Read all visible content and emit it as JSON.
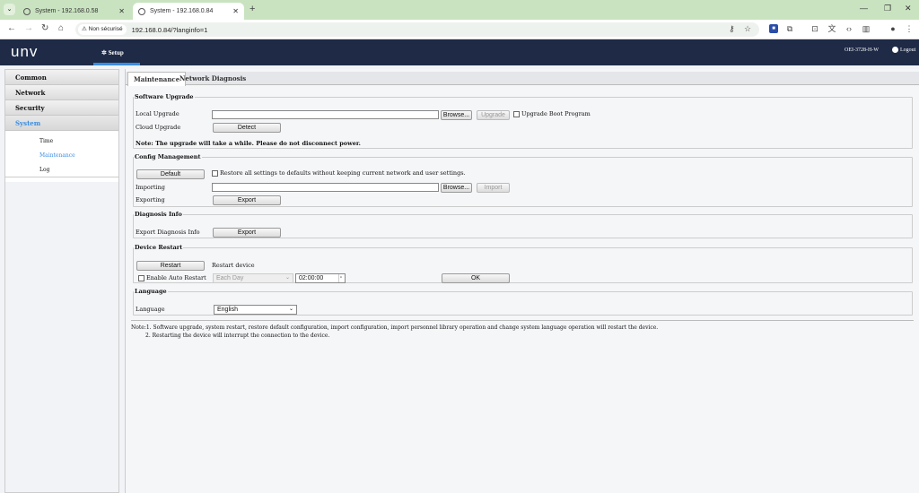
{
  "browser": {
    "tabs": [
      {
        "title": "System - 192.168.0.58"
      },
      {
        "title": "System - 192.168.0.84"
      }
    ],
    "security_label": "Non sécurisé",
    "url": "192.168.0.84/?langinfo=1"
  },
  "header": {
    "logo": "unv",
    "setup_label": "Setup",
    "device_model": "OEI-3728-H-W",
    "logout_label": "Logout"
  },
  "sidebar": {
    "groups": [
      {
        "label": "Common"
      },
      {
        "label": "Network"
      },
      {
        "label": "Security"
      },
      {
        "label": "System"
      }
    ],
    "system_items": [
      {
        "label": "Time"
      },
      {
        "label": "Maintenance"
      },
      {
        "label": "Log"
      }
    ]
  },
  "tabs": [
    {
      "label": "Maintenance"
    },
    {
      "label": "Network Diagnosis"
    }
  ],
  "software_upgrade": {
    "legend": "Software Upgrade",
    "local_upgrade_label": "Local Upgrade",
    "browse_label": "Browse...",
    "upgrade_label": "Upgrade",
    "boot_program_label": "Upgrade Boot Program",
    "cloud_upgrade_label": "Cloud Upgrade",
    "detect_label": "Detect",
    "note": "Note: The upgrade will take a while. Please do not disconnect power."
  },
  "config_management": {
    "legend": "Config Management",
    "default_label": "Default",
    "restore_label": "Restore all settings to defaults without keeping current network and user settings.",
    "importing_label": "Importing",
    "browse_label": "Browse...",
    "import_label": "Import",
    "exporting_label": "Exporting",
    "export_label": "Export"
  },
  "diagnosis_info": {
    "legend": "Diagnosis Info",
    "export_info_label": "Export Diagnosis Info",
    "export_label": "Export"
  },
  "device_restart": {
    "legend": "Device Restart",
    "restart_label": "Restart",
    "restart_device_label": "Restart device",
    "auto_restart_label": "Enable Auto Restart",
    "frequency_value": "Each Day",
    "time_value": "02:00:00",
    "ok_label": "OK"
  },
  "language": {
    "legend": "Language",
    "label": "Language",
    "value": "English"
  },
  "footer_note": {
    "line1": "Note:1. Software upgrade, system restart, restore default configuration, import configuration, import personnel library operation and change system language operation will restart the device.",
    "line2": "2. Restarting the device will interrupt the connection to the device."
  }
}
